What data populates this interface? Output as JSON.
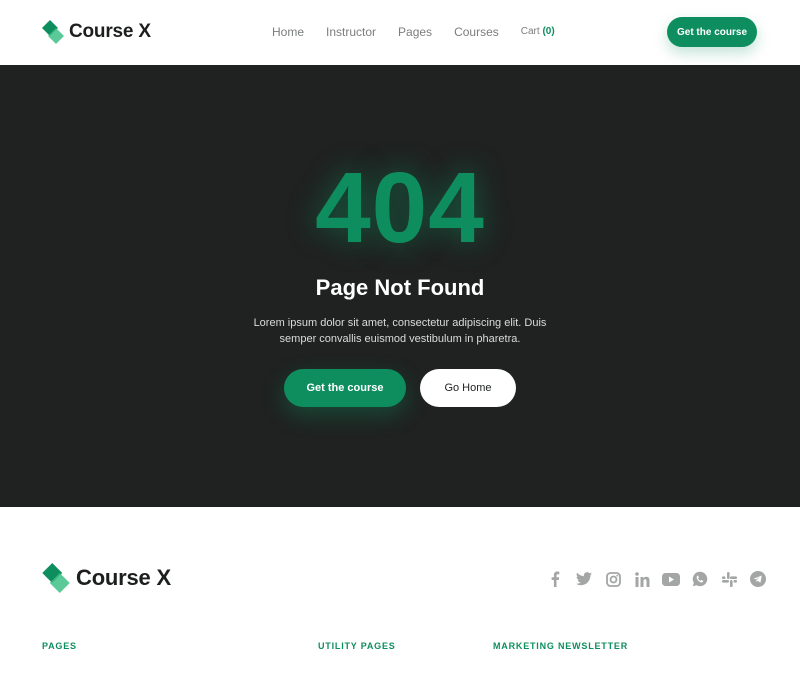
{
  "header": {
    "logo_text": "Course X",
    "nav": {
      "home": "Home",
      "instructor": "Instructor",
      "pages": "Pages",
      "courses": "Courses",
      "cart_label": "Cart",
      "cart_count": "(0)"
    },
    "cta_label": "Get the course"
  },
  "hero": {
    "code": "404",
    "title": "Page Not Found",
    "text": "Lorem ipsum dolor sit amet, consectetur adipiscing elit. Duis semper convallis euismod vestibulum in pharetra.",
    "primary_button": "Get the course",
    "secondary_button": "Go Home"
  },
  "footer": {
    "logo_text": "Course X",
    "socials": [
      "facebook-icon",
      "twitter-icon",
      "instagram-icon",
      "linkedin-icon",
      "youtube-icon",
      "whatsapp-icon",
      "slack-icon",
      "telegram-icon"
    ],
    "columns": {
      "pages": "PAGES",
      "utility": "UTILITY PAGES",
      "newsletter": "MARKETING NEWSLETTER"
    }
  },
  "colors": {
    "brand_green": "#0e8e5f",
    "hero_bg": "#1f2221",
    "icon_gray": "#a3a6a5"
  }
}
